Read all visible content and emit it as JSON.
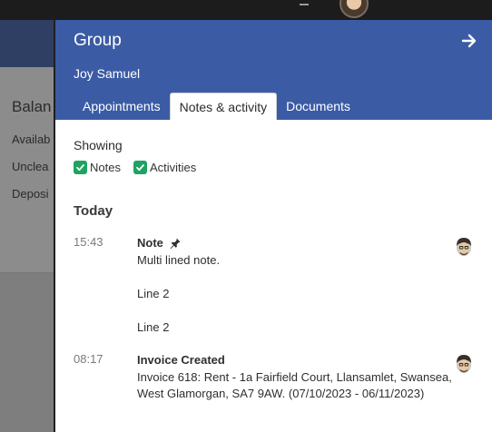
{
  "background": {
    "balance_title": "Balan",
    "rows": [
      "Availab",
      "Unclea",
      "Deposi"
    ]
  },
  "drawer": {
    "title": "Group",
    "subtitle": "Joy Samuel",
    "tabs": [
      {
        "label": "Appointments",
        "active": false
      },
      {
        "label": "Notes & activity",
        "active": true
      },
      {
        "label": "Documents",
        "active": false
      }
    ],
    "showing_label": "Showing",
    "filters": [
      {
        "label": "Notes",
        "checked": true
      },
      {
        "label": "Activities",
        "checked": true
      }
    ],
    "day_heading": "Today",
    "entries": [
      {
        "time": "15:43",
        "title": "Note",
        "pinned": true,
        "body": "Multi lined note.\n\nLine 2\n\nLine 2"
      },
      {
        "time": "08:17",
        "title": "Invoice Created",
        "pinned": false,
        "body": " Invoice 618: Rent - 1a Fairfield Court, Llansamlet, Swansea, West Glamorgan, SA7 9AW. (07/10/2023 - 06/11/2023)"
      }
    ]
  },
  "colors": {
    "header_blue": "#3b5ba5",
    "check_green": "#1ea362",
    "overlay_gray": "#8a8a8a"
  },
  "icons": {
    "close": "arrow-right-icon",
    "pin": "pin-icon",
    "check": "checkmark-icon"
  }
}
